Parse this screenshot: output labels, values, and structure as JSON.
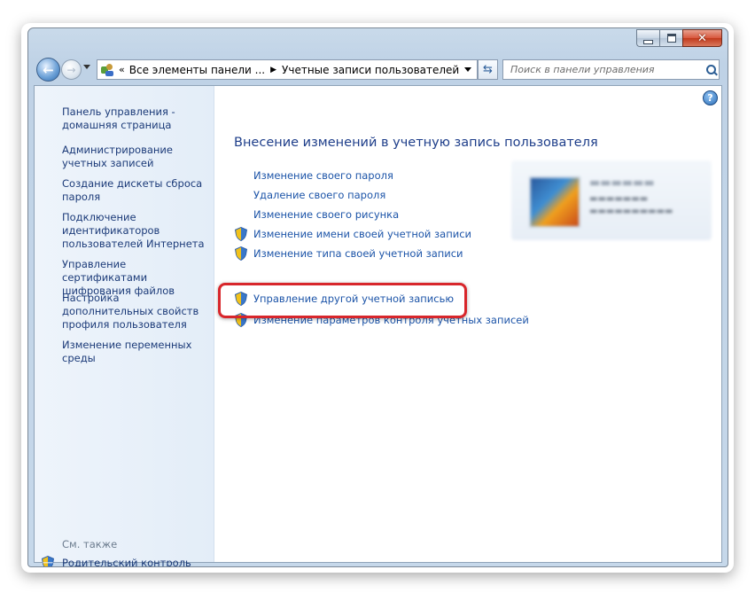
{
  "window": {
    "caption_buttons": {
      "minimize": "—",
      "maximize": "□",
      "close": "✕"
    }
  },
  "navbar": {
    "back_icon": "back-arrow-icon",
    "forward_icon": "forward-arrow-icon",
    "breadcrumb": {
      "overflow": "«",
      "item1": "Все элементы панели ...",
      "separator": "▶",
      "item2": "Учетные записи пользователей"
    },
    "refresh_glyph": "⇆",
    "search_placeholder": "Поиск в панели управления"
  },
  "sidebar": {
    "items": [
      "Панель управления - домашняя страница",
      "Администрирование учетных записей",
      "Создание дискеты сброса пароля",
      "Подключение идентификаторов пользователей Интернета",
      "Управление сертификатами шифрования файлов",
      "Настройка дополнительных свойств профиля пользователя",
      "Изменение переменных среды"
    ],
    "see_also": "См. также",
    "parental_control": "Родительский контроль"
  },
  "main": {
    "title": "Внесение изменений в учетную запись пользователя",
    "tasks": [
      {
        "label": "Изменение своего пароля",
        "shield": false
      },
      {
        "label": "Удаление своего пароля",
        "shield": false
      },
      {
        "label": "Изменение своего рисунка",
        "shield": false
      },
      {
        "label": "Изменение имени своей учетной записи",
        "shield": true
      },
      {
        "label": "Изменение типа своей учетной записи",
        "shield": true
      },
      {
        "label": "Управление другой учетной записью",
        "shield": true
      },
      {
        "label": "Изменение параметров контроля учетных записей",
        "shield": true
      }
    ],
    "help_glyph": "?"
  },
  "colors": {
    "link": "#1c54a8",
    "title": "#1e3e8a",
    "highlight": "#d8262b"
  }
}
